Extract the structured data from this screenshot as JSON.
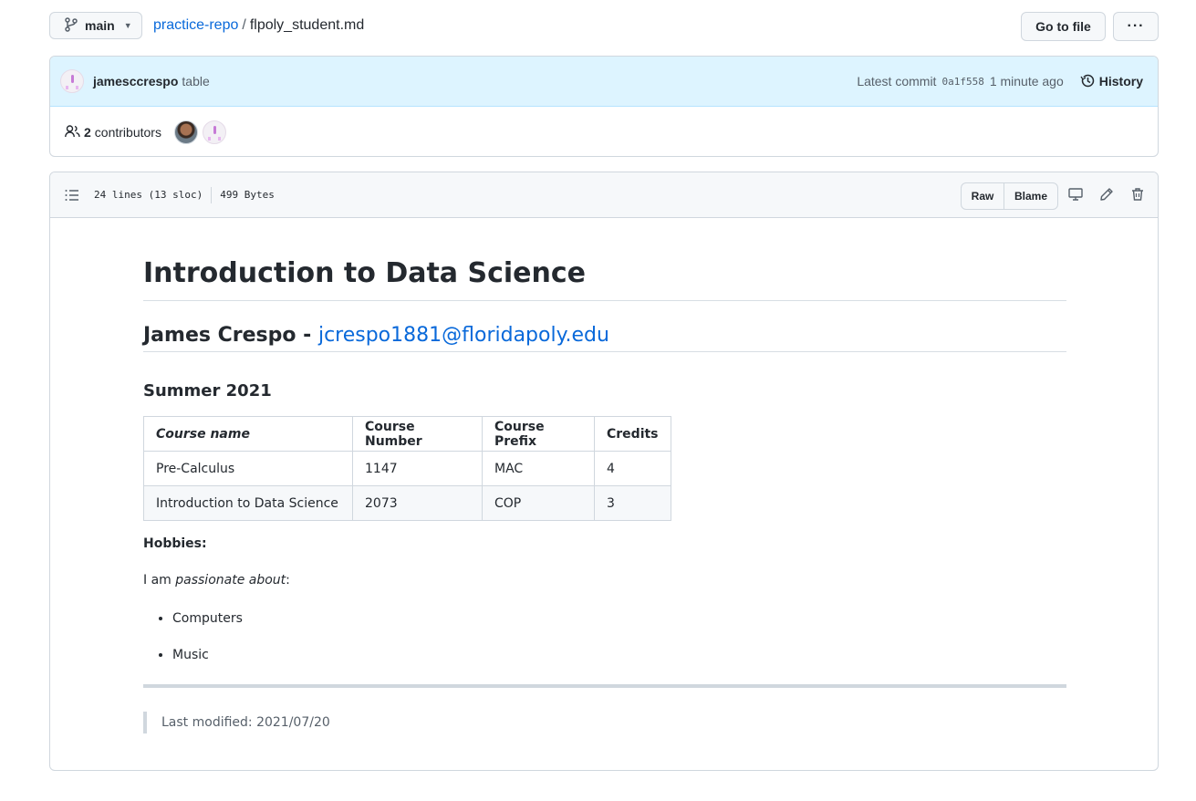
{
  "topbar": {
    "branch_label": "main",
    "repo_name": "practice-repo",
    "separator": "/",
    "file_name": "flpoly_student.md",
    "goto_file_label": "Go to file",
    "more_label": "···"
  },
  "commit": {
    "author": "jamesccrespo",
    "message": "table",
    "latest_commit_label": "Latest commit",
    "sha": "0a1f558",
    "time_ago": "1 minute ago",
    "history_label": "History"
  },
  "contributors": {
    "count": "2",
    "label": "contributors"
  },
  "file_header": {
    "lines_info": "24 lines (13 sloc)",
    "size": "499 Bytes",
    "raw_label": "Raw",
    "blame_label": "Blame"
  },
  "markdown": {
    "h1": "Introduction to Data Science",
    "h2_name": "James Crespo - ",
    "h2_email": "jcrespo1881@floridapoly.edu",
    "h3": "Summer 2021",
    "table": {
      "headers": [
        "Course name",
        "Course Number",
        "Course Prefix",
        "Credits"
      ],
      "rows": [
        [
          "Pre-Calculus",
          "1147",
          "MAC",
          "4"
        ],
        [
          "Introduction to Data Science",
          "2073",
          "COP",
          "3"
        ]
      ]
    },
    "hobbies_label": "Hobbies:",
    "passion_prefix": "I am ",
    "passion_italic": "passionate about",
    "passion_suffix": ":",
    "list": [
      "Computers",
      "Music"
    ],
    "last_modified": "Last modified: 2021/07/20"
  },
  "colors": {
    "accent_link": "#0969da",
    "commit_bg": "#ddf4ff",
    "border": "#d0d7de"
  }
}
